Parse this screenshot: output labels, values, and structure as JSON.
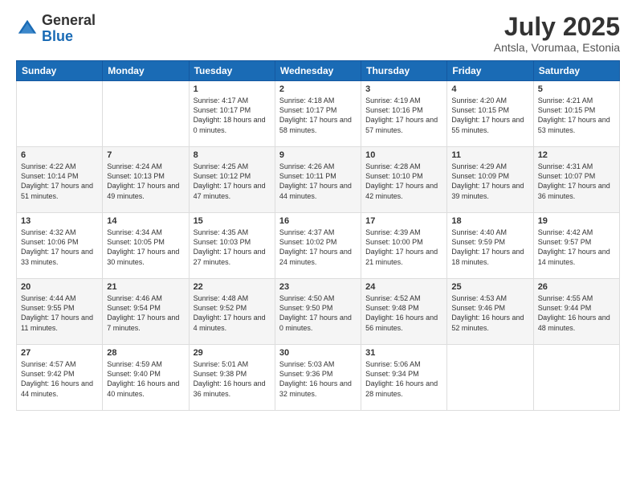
{
  "header": {
    "logo_general": "General",
    "logo_blue": "Blue",
    "main_title": "July 2025",
    "subtitle": "Antsla, Vorumaa, Estonia"
  },
  "days_of_week": [
    "Sunday",
    "Monday",
    "Tuesday",
    "Wednesday",
    "Thursday",
    "Friday",
    "Saturday"
  ],
  "weeks": [
    [
      {
        "day": "",
        "text": ""
      },
      {
        "day": "",
        "text": ""
      },
      {
        "day": "1",
        "text": "Sunrise: 4:17 AM\nSunset: 10:17 PM\nDaylight: 18 hours and 0 minutes."
      },
      {
        "day": "2",
        "text": "Sunrise: 4:18 AM\nSunset: 10:17 PM\nDaylight: 17 hours and 58 minutes."
      },
      {
        "day": "3",
        "text": "Sunrise: 4:19 AM\nSunset: 10:16 PM\nDaylight: 17 hours and 57 minutes."
      },
      {
        "day": "4",
        "text": "Sunrise: 4:20 AM\nSunset: 10:15 PM\nDaylight: 17 hours and 55 minutes."
      },
      {
        "day": "5",
        "text": "Sunrise: 4:21 AM\nSunset: 10:15 PM\nDaylight: 17 hours and 53 minutes."
      }
    ],
    [
      {
        "day": "6",
        "text": "Sunrise: 4:22 AM\nSunset: 10:14 PM\nDaylight: 17 hours and 51 minutes."
      },
      {
        "day": "7",
        "text": "Sunrise: 4:24 AM\nSunset: 10:13 PM\nDaylight: 17 hours and 49 minutes."
      },
      {
        "day": "8",
        "text": "Sunrise: 4:25 AM\nSunset: 10:12 PM\nDaylight: 17 hours and 47 minutes."
      },
      {
        "day": "9",
        "text": "Sunrise: 4:26 AM\nSunset: 10:11 PM\nDaylight: 17 hours and 44 minutes."
      },
      {
        "day": "10",
        "text": "Sunrise: 4:28 AM\nSunset: 10:10 PM\nDaylight: 17 hours and 42 minutes."
      },
      {
        "day": "11",
        "text": "Sunrise: 4:29 AM\nSunset: 10:09 PM\nDaylight: 17 hours and 39 minutes."
      },
      {
        "day": "12",
        "text": "Sunrise: 4:31 AM\nSunset: 10:07 PM\nDaylight: 17 hours and 36 minutes."
      }
    ],
    [
      {
        "day": "13",
        "text": "Sunrise: 4:32 AM\nSunset: 10:06 PM\nDaylight: 17 hours and 33 minutes."
      },
      {
        "day": "14",
        "text": "Sunrise: 4:34 AM\nSunset: 10:05 PM\nDaylight: 17 hours and 30 minutes."
      },
      {
        "day": "15",
        "text": "Sunrise: 4:35 AM\nSunset: 10:03 PM\nDaylight: 17 hours and 27 minutes."
      },
      {
        "day": "16",
        "text": "Sunrise: 4:37 AM\nSunset: 10:02 PM\nDaylight: 17 hours and 24 minutes."
      },
      {
        "day": "17",
        "text": "Sunrise: 4:39 AM\nSunset: 10:00 PM\nDaylight: 17 hours and 21 minutes."
      },
      {
        "day": "18",
        "text": "Sunrise: 4:40 AM\nSunset: 9:59 PM\nDaylight: 17 hours and 18 minutes."
      },
      {
        "day": "19",
        "text": "Sunrise: 4:42 AM\nSunset: 9:57 PM\nDaylight: 17 hours and 14 minutes."
      }
    ],
    [
      {
        "day": "20",
        "text": "Sunrise: 4:44 AM\nSunset: 9:55 PM\nDaylight: 17 hours and 11 minutes."
      },
      {
        "day": "21",
        "text": "Sunrise: 4:46 AM\nSunset: 9:54 PM\nDaylight: 17 hours and 7 minutes."
      },
      {
        "day": "22",
        "text": "Sunrise: 4:48 AM\nSunset: 9:52 PM\nDaylight: 17 hours and 4 minutes."
      },
      {
        "day": "23",
        "text": "Sunrise: 4:50 AM\nSunset: 9:50 PM\nDaylight: 17 hours and 0 minutes."
      },
      {
        "day": "24",
        "text": "Sunrise: 4:52 AM\nSunset: 9:48 PM\nDaylight: 16 hours and 56 minutes."
      },
      {
        "day": "25",
        "text": "Sunrise: 4:53 AM\nSunset: 9:46 PM\nDaylight: 16 hours and 52 minutes."
      },
      {
        "day": "26",
        "text": "Sunrise: 4:55 AM\nSunset: 9:44 PM\nDaylight: 16 hours and 48 minutes."
      }
    ],
    [
      {
        "day": "27",
        "text": "Sunrise: 4:57 AM\nSunset: 9:42 PM\nDaylight: 16 hours and 44 minutes."
      },
      {
        "day": "28",
        "text": "Sunrise: 4:59 AM\nSunset: 9:40 PM\nDaylight: 16 hours and 40 minutes."
      },
      {
        "day": "29",
        "text": "Sunrise: 5:01 AM\nSunset: 9:38 PM\nDaylight: 16 hours and 36 minutes."
      },
      {
        "day": "30",
        "text": "Sunrise: 5:03 AM\nSunset: 9:36 PM\nDaylight: 16 hours and 32 minutes."
      },
      {
        "day": "31",
        "text": "Sunrise: 5:06 AM\nSunset: 9:34 PM\nDaylight: 16 hours and 28 minutes."
      },
      {
        "day": "",
        "text": ""
      },
      {
        "day": "",
        "text": ""
      }
    ]
  ]
}
